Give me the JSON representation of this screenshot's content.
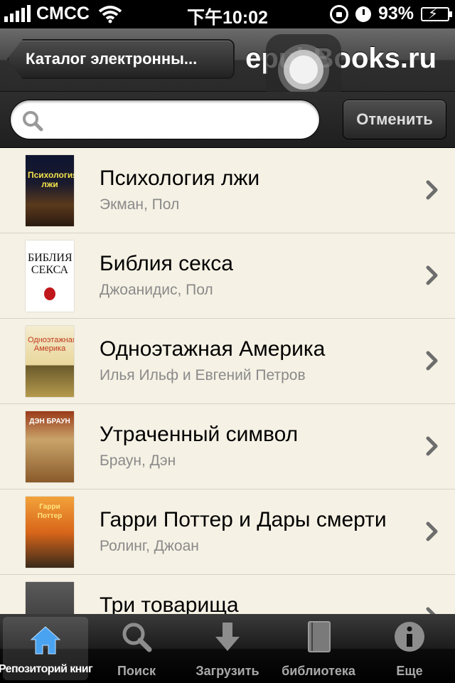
{
  "status_bar": {
    "carrier": "CMCC",
    "time": "下午10:02",
    "battery": "93%"
  },
  "nav": {
    "back_label": "Каталог электронны...",
    "title": "epubBooks.ru"
  },
  "search": {
    "placeholder": "",
    "value": "",
    "cancel_label": "Отменить"
  },
  "books": [
    {
      "title": "Психология лжи",
      "author": "Экман, Пол",
      "cover_text": "Психология лжи"
    },
    {
      "title": "Библия секса",
      "author": "Джоанидис, Пол",
      "cover_text": "БИБЛИЯ СЕКСА"
    },
    {
      "title": "Одноэтажная Америка",
      "author": "Илья Ильф и Евгений Петров",
      "cover_text": "Одноэтажная Америка"
    },
    {
      "title": "Утраченный символ",
      "author": "Браун, Дэн",
      "cover_text": "ДЭН БРАУН"
    },
    {
      "title": "Гарри Поттер и Дары смерти",
      "author": "Ролинг, Джоан",
      "cover_text": "Гарри Поттер"
    },
    {
      "title": "Три товарища",
      "author": "",
      "cover_text": ""
    }
  ],
  "tabs": [
    {
      "label": "Репозиторий книг",
      "icon": "home-icon",
      "active": true
    },
    {
      "label": "Поиск",
      "icon": "search-icon",
      "active": false
    },
    {
      "label": "Загрузить",
      "icon": "download-icon",
      "active": false
    },
    {
      "label": "библиотека",
      "icon": "book-icon",
      "active": false
    },
    {
      "label": "Еще",
      "icon": "info-icon",
      "active": false
    }
  ],
  "colors": {
    "list_background": "#f5f1e4",
    "active_tab_icon": "#4aa3f0"
  }
}
